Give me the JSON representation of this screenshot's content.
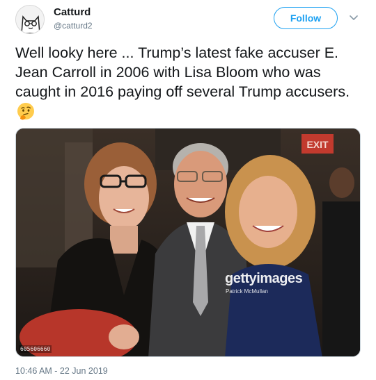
{
  "author": {
    "display_name": "Catturd",
    "handle": "@catturd2",
    "avatar_icon": "cat-cartoon-avatar"
  },
  "actions": {
    "follow_label": "Follow",
    "menu_icon": "chevron-down-icon"
  },
  "tweet": {
    "text": "Well looky here ... Trump’s latest fake accuser E. Jean Carroll in 2006 with Lisa Bloom who was caught in 2016 paying off several Trump accusers.",
    "emoji_icon": "thinking-face-emoji",
    "timestamp": "10:46 AM - 22 Jun 2019"
  },
  "media": {
    "watermark": "gettyimages",
    "credit": "Patrick McMullan",
    "image_id": "605606660",
    "exit_sign": "EXIT"
  },
  "colors": {
    "accent": "#1da1f2",
    "text": "#14171a",
    "secondary": "#657786"
  }
}
